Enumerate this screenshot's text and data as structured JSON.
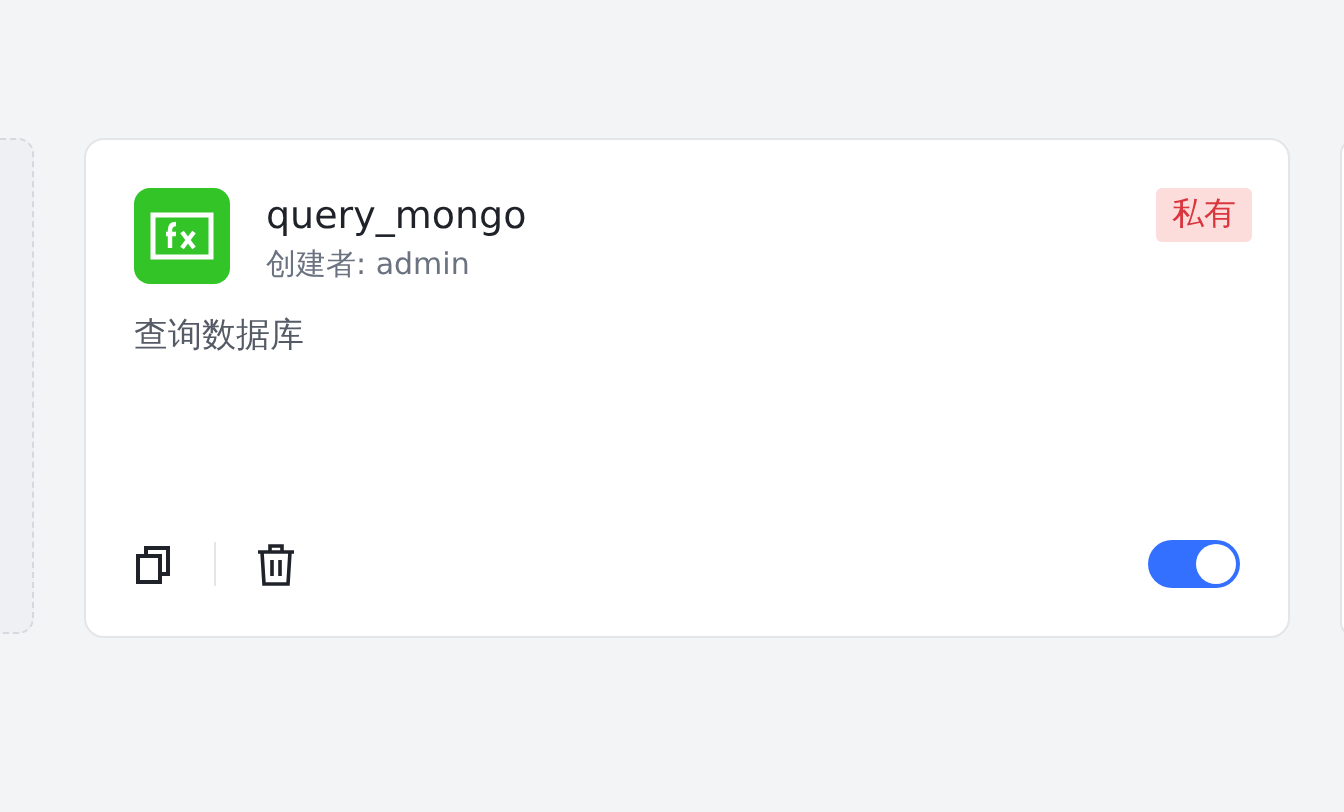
{
  "card": {
    "title": "query_mongo",
    "creator": "创建者: admin",
    "description": "查询数据库",
    "badge": "私有",
    "enabled": true
  }
}
